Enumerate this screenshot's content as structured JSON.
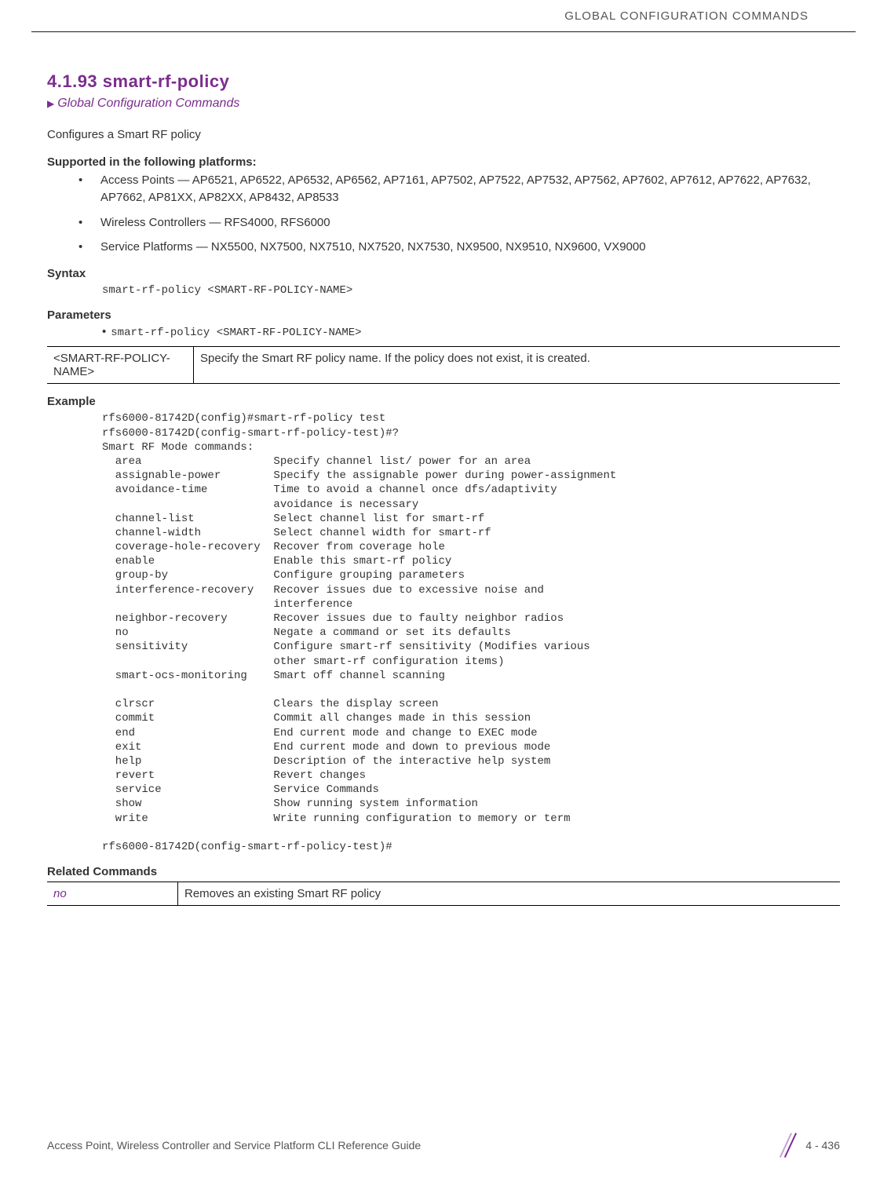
{
  "header": {
    "running_head": "GLOBAL CONFIGURATION COMMANDS"
  },
  "section": {
    "number_title": "4.1.93 smart-rf-policy",
    "breadcrumb_arrow": "▶",
    "breadcrumb": "Global Configuration Commands",
    "intro": "Configures a Smart RF policy"
  },
  "platforms": {
    "heading": "Supported in the following platforms:",
    "items": [
      "Access Points — AP6521, AP6522, AP6532, AP6562, AP7161, AP7502, AP7522, AP7532, AP7562, AP7602, AP7612, AP7622, AP7632, AP7662, AP81XX, AP82XX, AP8432, AP8533",
      "Wireless Controllers — RFS4000, RFS6000",
      "Service Platforms — NX5500, NX7500, NX7510, NX7520, NX7530, NX9500, NX9510, NX9600, VX9000"
    ]
  },
  "syntax": {
    "heading": "Syntax",
    "line": "smart-rf-policy <SMART-RF-POLICY-NAME>"
  },
  "parameters": {
    "heading": "Parameters",
    "bullet_line": "smart-rf-policy <SMART-RF-POLICY-NAME>",
    "table": {
      "name": "<SMART-RF-POLICY-NAME>",
      "desc": "Specify the Smart RF policy name. If the policy does not exist, it is created."
    }
  },
  "example": {
    "heading": "Example",
    "text": "rfs6000-81742D(config)#smart-rf-policy test\nrfs6000-81742D(config-smart-rf-policy-test)#?\nSmart RF Mode commands:\n  area                    Specify channel list/ power for an area\n  assignable-power        Specify the assignable power during power-assignment\n  avoidance-time          Time to avoid a channel once dfs/adaptivity\n                          avoidance is necessary\n  channel-list            Select channel list for smart-rf\n  channel-width           Select channel width for smart-rf\n  coverage-hole-recovery  Recover from coverage hole\n  enable                  Enable this smart-rf policy\n  group-by                Configure grouping parameters\n  interference-recovery   Recover issues due to excessive noise and\n                          interference\n  neighbor-recovery       Recover issues due to faulty neighbor radios\n  no                      Negate a command or set its defaults\n  sensitivity             Configure smart-rf sensitivity (Modifies various\n                          other smart-rf configuration items)\n  smart-ocs-monitoring    Smart off channel scanning\n\n  clrscr                  Clears the display screen\n  commit                  Commit all changes made in this session\n  end                     End current mode and change to EXEC mode\n  exit                    End current mode and down to previous mode\n  help                    Description of the interactive help system\n  revert                  Revert changes\n  service                 Service Commands\n  show                    Show running system information\n  write                   Write running configuration to memory or term\n\nrfs6000-81742D(config-smart-rf-policy-test)#"
  },
  "related": {
    "heading": "Related Commands",
    "cmd": "no",
    "desc": "Removes an existing Smart RF policy"
  },
  "footer": {
    "guide": "Access Point, Wireless Controller and Service Platform CLI Reference Guide",
    "pagenum": "4 - 436"
  }
}
